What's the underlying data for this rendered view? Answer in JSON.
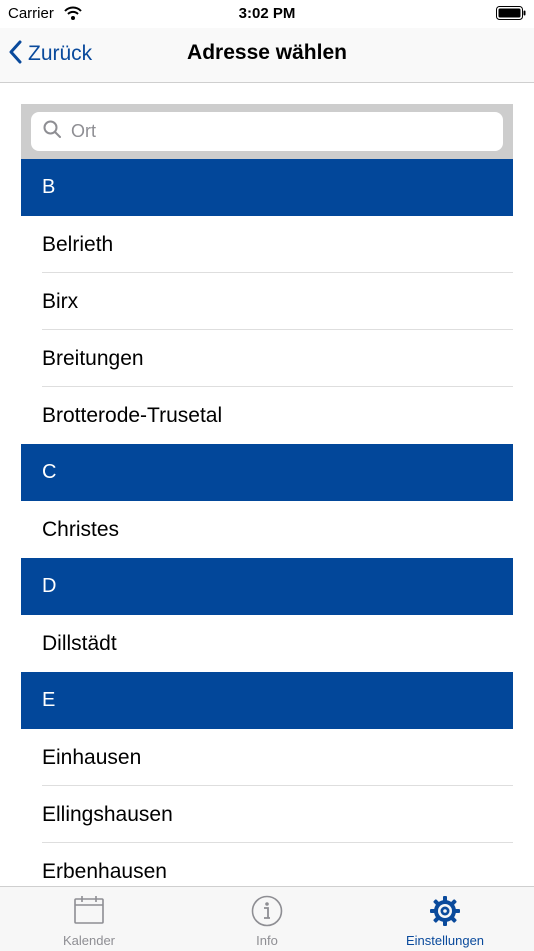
{
  "status_bar": {
    "carrier": "Carrier",
    "time": "3:02 PM"
  },
  "nav": {
    "back_label": "Zurück",
    "title": "Adresse wählen"
  },
  "search": {
    "placeholder": "Ort"
  },
  "sections": [
    {
      "letter": "B",
      "items": [
        "Belrieth",
        "Birx",
        "Breitungen",
        "Brotterode-Trusetal"
      ]
    },
    {
      "letter": "C",
      "items": [
        "Christes"
      ]
    },
    {
      "letter": "D",
      "items": [
        "Dillstädt"
      ]
    },
    {
      "letter": "E",
      "items": [
        "Einhausen",
        "Ellingshausen",
        "Erbenhausen"
      ]
    }
  ],
  "tabs": [
    {
      "label": "Kalender",
      "icon": "calendar-icon",
      "active": false
    },
    {
      "label": "Info",
      "icon": "info-icon",
      "active": false
    },
    {
      "label": "Einstellungen",
      "icon": "gear-icon",
      "active": true
    }
  ],
  "colors": {
    "accent": "#0a4a9c",
    "section_header": "#02479a",
    "tab_inactive": "#8e8e93"
  }
}
